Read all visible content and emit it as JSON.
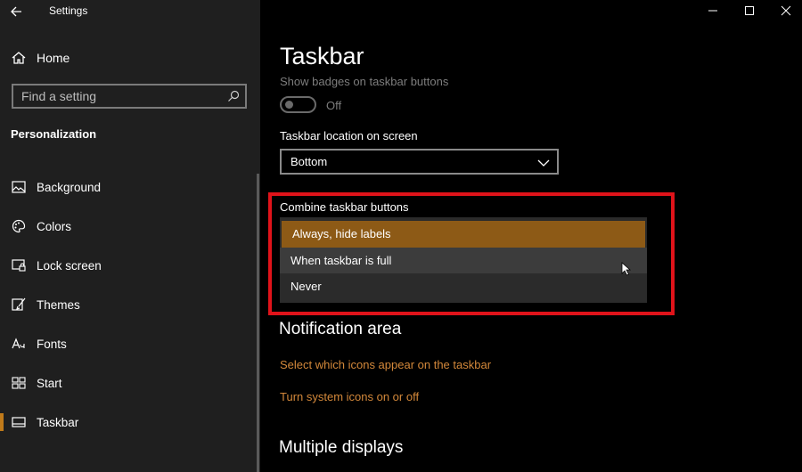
{
  "window": {
    "app_title": "Settings",
    "controls": [
      "minimize",
      "maximize",
      "close"
    ]
  },
  "sidebar": {
    "home_label": "Home",
    "search": {
      "placeholder": "Find a setting"
    },
    "section_title": "Personalization",
    "items": [
      {
        "label": "Background",
        "icon": "picture-icon"
      },
      {
        "label": "Colors",
        "icon": "palette-icon"
      },
      {
        "label": "Lock screen",
        "icon": "lock-screen-icon"
      },
      {
        "label": "Themes",
        "icon": "themes-brush-icon"
      },
      {
        "label": "Fonts",
        "icon": "font-icon"
      },
      {
        "label": "Start",
        "icon": "start-tiles-icon"
      },
      {
        "label": "Taskbar",
        "icon": "taskbar-icon",
        "active": true
      }
    ]
  },
  "main": {
    "title": "Taskbar",
    "badges": {
      "label": "Show badges on taskbar buttons",
      "state": "Off"
    },
    "location": {
      "label": "Taskbar location on screen",
      "value": "Bottom"
    },
    "combine": {
      "label": "Combine taskbar buttons",
      "options": [
        "Always, hide labels",
        "When taskbar is full",
        "Never"
      ],
      "selected": "Always, hide labels"
    },
    "notification_area": {
      "heading": "Notification area",
      "links": [
        "Select which icons appear on the taskbar",
        "Turn system icons on or off"
      ]
    },
    "multiple_displays": {
      "heading": "Multiple displays"
    }
  },
  "colors": {
    "accent": "#d3883a",
    "selected_option": "#8d5a16",
    "highlight_box": "#e0131a"
  }
}
